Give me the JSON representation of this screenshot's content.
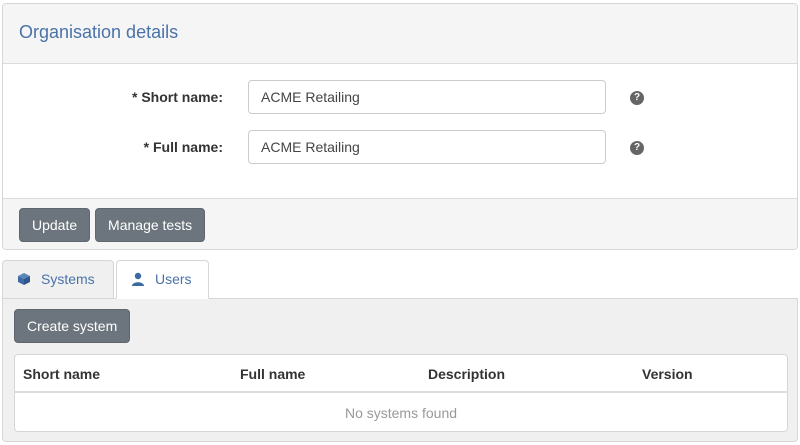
{
  "panel": {
    "title": "Organisation details",
    "fields": [
      {
        "label": "* Short name:",
        "value": "ACME Retailing",
        "help": "?"
      },
      {
        "label": "* Full name:",
        "value": "ACME Retailing",
        "help": "?"
      }
    ],
    "buttons": {
      "update": "Update",
      "manage_tests": "Manage tests"
    }
  },
  "tabs": [
    {
      "label": "Systems",
      "icon": "cube-icon",
      "active": true
    },
    {
      "label": "Users",
      "icon": "user-icon",
      "active": false
    }
  ],
  "systems": {
    "create_label": "Create system",
    "columns": [
      "Short name",
      "Full name",
      "Description",
      "Version"
    ],
    "empty_message": "No systems found"
  },
  "colors": {
    "accent": "#4a72a8",
    "button": "#6c757d",
    "panel_bg": "#f5f5f5"
  }
}
